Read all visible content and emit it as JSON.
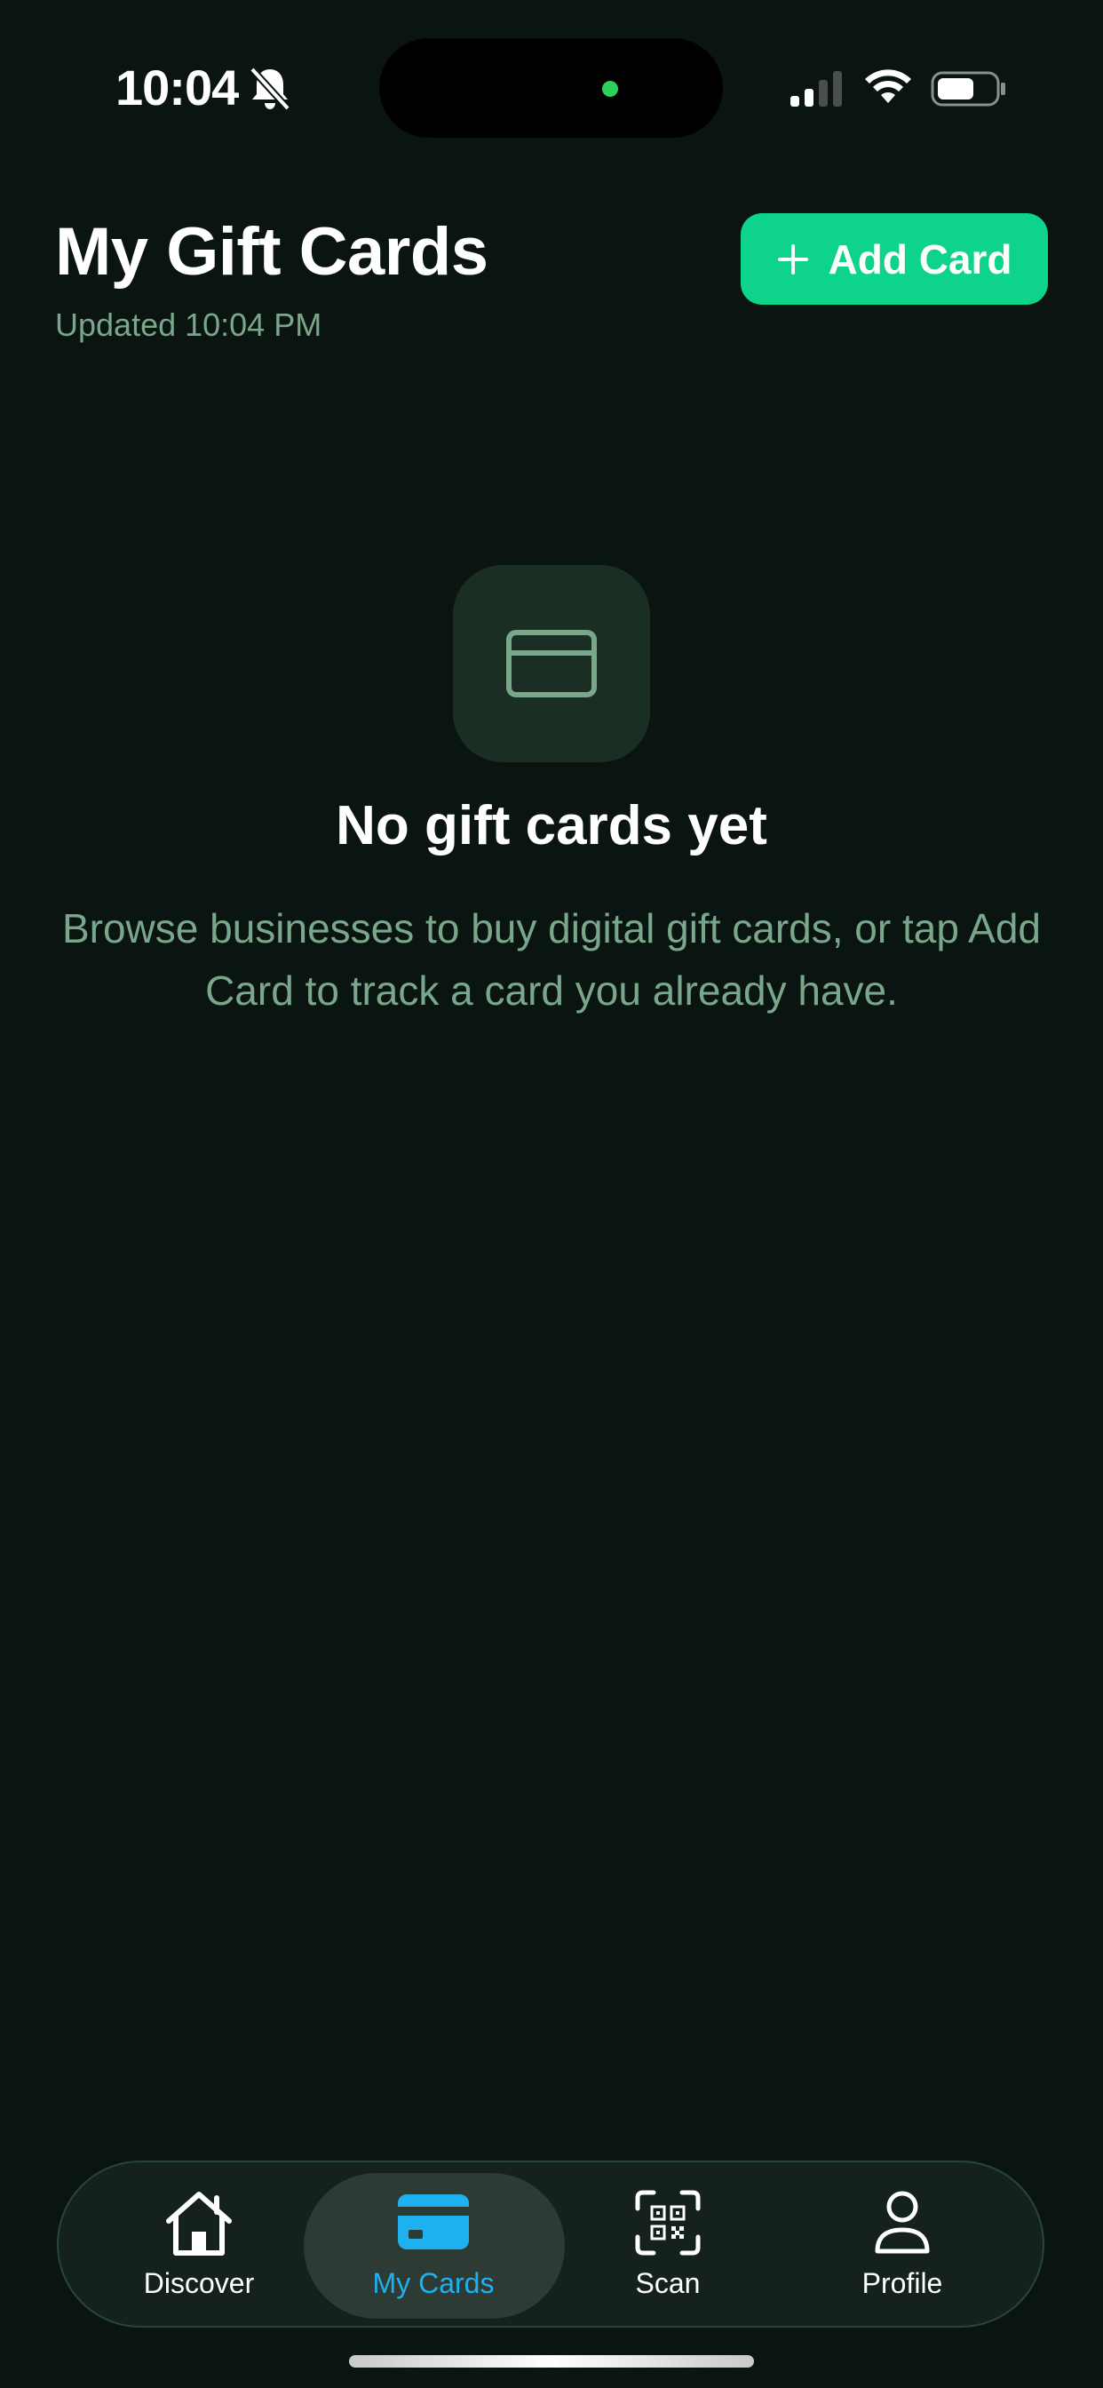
{
  "status_bar": {
    "time": "10:04",
    "icons": [
      "bell-off-icon",
      "signal-icon",
      "wifi-icon",
      "battery-icon"
    ]
  },
  "header": {
    "title": "My Gift Cards",
    "updated": "Updated 10:04 PM",
    "add_button_label": "Add Card"
  },
  "empty_state": {
    "icon": "credit-card-icon",
    "title": "No gift cards yet",
    "description": "Browse businesses to buy digital gift cards, or tap Add Card to track a card you already have."
  },
  "tab_bar": {
    "active": "My Cards",
    "items": [
      {
        "label": "Discover",
        "icon": "home-icon"
      },
      {
        "label": "My Cards",
        "icon": "credit-card-icon"
      },
      {
        "label": "Scan",
        "icon": "qr-scan-icon"
      },
      {
        "label": "Profile",
        "icon": "person-icon"
      }
    ]
  },
  "colors": {
    "background": "#0a1511",
    "accent": "#0dd38b",
    "active_tab": "#1fb0f0",
    "muted_text": "#7aa68c",
    "tile": "#1a2e24"
  }
}
